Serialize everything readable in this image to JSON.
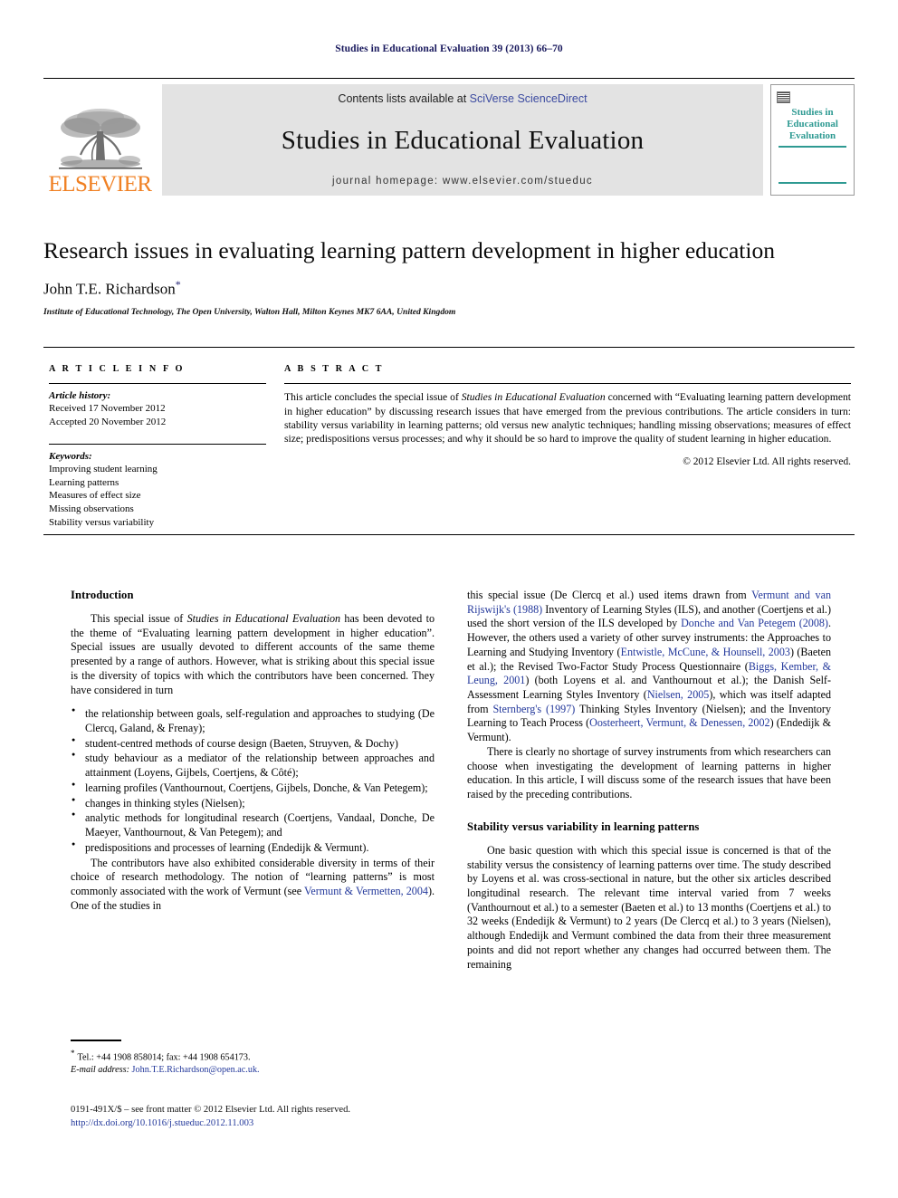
{
  "running_head": "Studies in Educational Evaluation 39 (2013) 66–70",
  "masthead": {
    "contents_prefix": "Contents lists available at ",
    "sciencedirect_link": "SciVerse ScienceDirect",
    "journal_name": "Studies in Educational Evaluation",
    "homepage": "journal homepage: www.elsevier.com/stueduc",
    "publisher_wordmark": "ELSEVIER",
    "cover_title_line1": "Studies in",
    "cover_title_line2": "Educational",
    "cover_title_line3": "Evaluation",
    "accent_color": "#2e9a92",
    "publisher_color": "#F08023",
    "link_color": "#3b4aa0"
  },
  "article": {
    "title": "Research issues in evaluating learning pattern development in higher education",
    "author": "John T.E. Richardson",
    "author_footnote_marker": "*",
    "affiliation": "Institute of Educational Technology, The Open University, Walton Hall, Milton Keynes MK7 6AA, United Kingdom"
  },
  "article_info": {
    "section_label": "A R T I C L E   I N F O",
    "history_label": "Article history:",
    "received": "Received 17 November 2012",
    "accepted": "Accepted 20 November 2012",
    "keywords_label": "Keywords:",
    "keywords": [
      "Improving student learning",
      "Learning patterns",
      "Measures of effect size",
      "Missing observations",
      "Stability versus variability"
    ]
  },
  "abstract": {
    "section_label": "A B S T R A C T",
    "part1": "This article concludes the special issue of ",
    "italic1": "Studies in Educational Evaluation",
    "part2": " concerned with “Evaluating learning pattern development in higher education” by discussing research issues that have emerged from the previous contributions. The article considers in turn: stability versus variability in learning patterns; old versus new analytic techniques; handling missing observations; measures of effect size; predispositions versus processes; and why it should be so hard to improve the quality of student learning in higher education.",
    "copyright": "© 2012 Elsevier Ltd. All rights reserved."
  },
  "body": {
    "intro_heading": "Introduction",
    "intro_p1_a": "This special issue of ",
    "intro_p1_italic": "Studies in Educational Evaluation",
    "intro_p1_b": " has been devoted to the theme of “Evaluating learning pattern development in higher education”. Special issues are usually devoted to different accounts of the same theme presented by a range of authors. However, what is striking about this special issue is the diversity of topics with which the contributors have been concerned. They have considered in turn",
    "bullets": [
      "the relationship between goals, self-regulation and approaches to studying (De Clercq, Galand, & Frenay);",
      "student-centred methods of course design (Baeten, Struyven, & Dochy)",
      "study behaviour as a mediator of the relationship between approaches and attainment (Loyens, Gijbels, Coertjens, & Côté);",
      "learning profiles (Vanthournout, Coertjens, Gijbels, Donche, & Van Petegem);",
      "changes in thinking styles (Nielsen);",
      "analytic methods for longitudinal research (Coertjens, Vandaal, Donche, De Maeyer, Vanthournout, & Van Petegem); and",
      "predispositions and processes of learning (Endedijk & Vermunt)."
    ],
    "intro_p2_a": "The contributors have also exhibited considerable diversity in terms of their choice of research methodology. The notion of “learning patterns” is most commonly associated with the work of Vermunt (see ",
    "intro_p2_ref": "Vermunt & Vermetten, 2004",
    "intro_p2_b": "). One of the studies in",
    "right_p1_a": "this special issue (De Clercq et al.) used items drawn from ",
    "right_p1_ref1": "Vermunt and van Rijswijk's (1988)",
    "right_p1_b": " Inventory of Learning Styles (ILS), and another (Coertjens et al.) used the short version of the ILS developed by ",
    "right_p1_ref2": "Donche and Van Petegem (2008)",
    "right_p1_c": ". However, the others used a variety of other survey instruments: the Approaches to Learning and Studying Inventory (",
    "right_p1_ref3": "Entwistle, McCune, & Hounsell, 2003",
    "right_p1_d": ") (Baeten et al.); the Revised Two-Factor Study Process Questionnaire (",
    "right_p1_ref4": "Biggs, Kember, & Leung, 2001",
    "right_p1_e": ") (both Loyens et al. and Vanthournout et al.); the Danish Self-Assessment Learning Styles Inventory (",
    "right_p1_ref5": "Nielsen, 2005",
    "right_p1_f": "), which was itself adapted from ",
    "right_p1_ref6": "Sternberg's (1997)",
    "right_p1_g": " Thinking Styles Inventory (Nielsen); and the Inventory Learning to Teach Process (",
    "right_p1_ref7": "Oosterheert, Vermunt, & Denessen, 2002",
    "right_p1_h": ") (Endedijk & Vermunt).",
    "right_p2": "There is clearly no shortage of survey instruments from which researchers can choose when investigating the development of learning patterns in higher education. In this article, I will discuss some of the research issues that have been raised by the preceding contributions.",
    "stability_heading": "Stability versus variability in learning patterns",
    "stability_p1": "One basic question with which this special issue is concerned is that of the stability versus the consistency of learning patterns over time. The study described by Loyens et al. was cross-sectional in nature, but the other six articles described longitudinal research. The relevant time interval varied from 7 weeks (Vanthournout et al.) to a semester (Baeten et al.) to 13 months (Coertjens et al.) to 32 weeks (Endedijk & Vermunt) to 2 years (De Clercq et al.) to 3 years (Nielsen), although Endedijk and Vermunt combined the data from their three measurement points and did not report whether any changes had occurred between them. The remaining"
  },
  "footnote": {
    "marker": "*",
    "tel_fax": "Tel.: +44 1908 858014; fax: +44 1908 654173.",
    "email_label": "E-mail address:",
    "email": "John.T.E.Richardson@open.ac.uk."
  },
  "page_footer": {
    "issn_line": "0191-491X/$ – see front matter © 2012 Elsevier Ltd. All rights reserved.",
    "doi": "http://dx.doi.org/10.1016/j.stueduc.2012.11.003"
  }
}
